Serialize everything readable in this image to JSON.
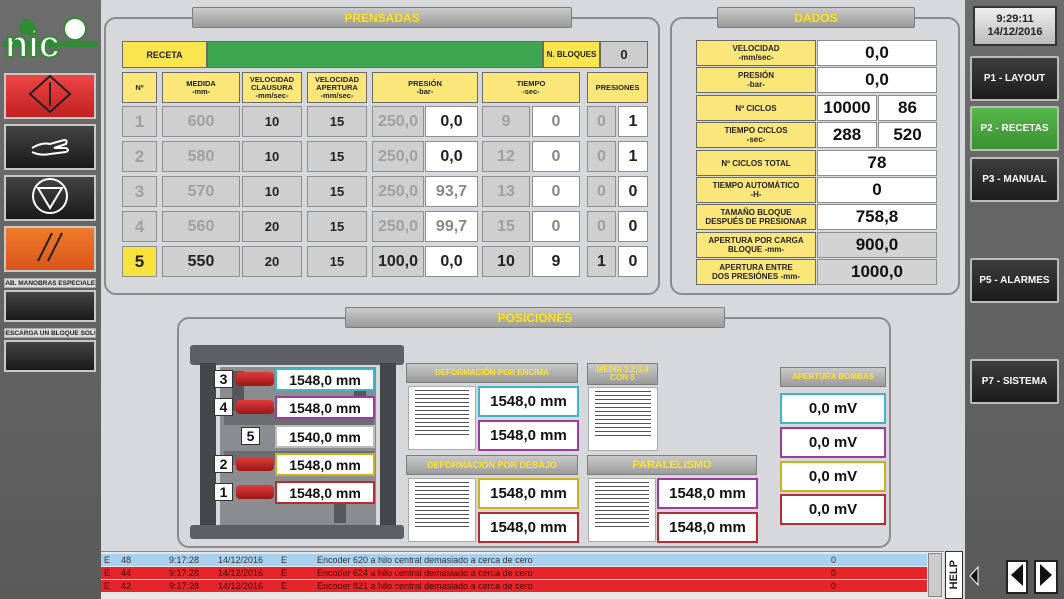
{
  "clock": {
    "time": "9:29:11",
    "date": "14/12/2016"
  },
  "nav": [
    {
      "label": "P1 - LAYOUT",
      "active": false
    },
    {
      "label": "P2 - RECETAS",
      "active": true
    },
    {
      "label": "P3 - MANUAL",
      "active": false
    },
    {
      "label": "P5 - ALARMES",
      "active": false
    },
    {
      "label": "P7 - SISTEMA",
      "active": false
    }
  ],
  "side": {
    "special_label": "HAB. MANOBRAS ESPECIALES",
    "unload_label": "DESCARGA UN BLOQUE SOLO"
  },
  "prensadas": {
    "title": "PRENSADAS",
    "receta_label": "RECETA",
    "bloques_label": "N. BLOQUES",
    "bloques_value": "0",
    "headers": {
      "n": "Nº",
      "medida": [
        "MEDIDA",
        "-mm-"
      ],
      "vel_cl": [
        "VELOCIDAD",
        "CLAUSURA",
        "-mm/sec-"
      ],
      "vel_ap": [
        "VELOCIDAD",
        "APERTURA",
        "-mm/sec-"
      ],
      "presion": [
        "PRESIÓN",
        "-bar-"
      ],
      "tiempo": [
        "TIEMPO",
        "-sec-"
      ],
      "presiones": "PRESIONES"
    },
    "rows": [
      {
        "n": "1",
        "medida": "600",
        "vcl": "10",
        "vap": "15",
        "pres_set": "250,0",
        "pres_act": "0,0",
        "t_set": "9",
        "t_act": "0",
        "p_set": "0",
        "p_act": "1"
      },
      {
        "n": "2",
        "medida": "580",
        "vcl": "10",
        "vap": "15",
        "pres_set": "250,0",
        "pres_act": "0,0",
        "t_set": "12",
        "t_act": "0",
        "p_set": "0",
        "p_act": "1"
      },
      {
        "n": "3",
        "medida": "570",
        "vcl": "10",
        "vap": "15",
        "pres_set": "250,0",
        "pres_act": "93,7",
        "t_set": "13",
        "t_act": "0",
        "p_set": "0",
        "p_act": "0"
      },
      {
        "n": "4",
        "medida": "560",
        "vcl": "20",
        "vap": "15",
        "pres_set": "250,0",
        "pres_act": "99,7",
        "t_set": "15",
        "t_act": "0",
        "p_set": "0",
        "p_act": "0"
      },
      {
        "n": "5",
        "medida": "550",
        "vcl": "20",
        "vap": "15",
        "pres_set": "100,0",
        "pres_act": "0,0",
        "t_set": "10",
        "t_act": "9",
        "p_set": "1",
        "p_act": "0"
      }
    ]
  },
  "dados": {
    "title": "DADOS",
    "rows": [
      {
        "label": [
          "VELOCIDAD",
          "-mm/sec-"
        ],
        "value": "0,0"
      },
      {
        "label": [
          "PRESIÓN",
          "-bar-"
        ],
        "value": "0,0"
      },
      {
        "label": [
          "Nº CICLOS"
        ],
        "value": "10000",
        "value2": "86"
      },
      {
        "label": [
          "TIEMPO CICLOS",
          "-sec-"
        ],
        "value": "288",
        "value2": "520"
      },
      {
        "label": [
          "Nº CICLOS TOTAL"
        ],
        "value": "78"
      },
      {
        "label": [
          "TIEMPO AUTOMÁTICO",
          "-H-"
        ],
        "value": "0"
      },
      {
        "label": [
          "TAMAÑO BLOQUE",
          "DESPUÉS DE PRESIONAR"
        ],
        "value": "758,8"
      },
      {
        "label": [
          "APERTURA POR CARGA",
          "BLOQUE -mm-"
        ],
        "value": "900,0"
      },
      {
        "label": [
          "APERTURA ENTRE",
          "DOS PRESIÓNES -mm-"
        ],
        "value": "1000,0"
      }
    ]
  },
  "posiciones": {
    "title": "POSICIÓNES",
    "cylinders": [
      {
        "num": "3",
        "value": "1548,0 mm",
        "color": "#3fb6c4"
      },
      {
        "num": "4",
        "value": "1548,0 mm",
        "color": "#9c3c9c"
      },
      {
        "num": "5",
        "value": "1540,0 mm",
        "color": "#ffffff"
      },
      {
        "num": "2",
        "value": "1548,0 mm",
        "color": "#c9b21c"
      },
      {
        "num": "1",
        "value": "1548,0 mm",
        "color": "#b52c33"
      }
    ],
    "def_encima": {
      "title": "DEFORMACIÓN POR ENCIMA",
      "values": [
        "1548,0 mm",
        "1548,0 mm"
      ]
    },
    "media": {
      "title": [
        "MEDIA 1,2,3,4",
        "CON 5"
      ]
    },
    "def_debajo": {
      "title": "DEFORMACIÓN POR DEBAJO",
      "values": [
        "1548,0 mm",
        "1548,0 mm"
      ]
    },
    "paralelismo": {
      "title": "PARALELISMO",
      "values": [
        "1548,0 mm",
        "1548,0 mm"
      ]
    },
    "bombas": {
      "title": "APERTURA BOMBAS",
      "values": [
        "0,0 mV",
        "0,0 mV",
        "0,0 mV",
        "0,0 mV"
      ]
    }
  },
  "alarms": [
    {
      "flag": "E",
      "id": "48",
      "time": "9:17:28",
      "date": "14/12/2016",
      "type": "E",
      "text": "Encoder 620 a hilo central demasiado a cerca de cero",
      "count": "0"
    },
    {
      "flag": "E",
      "id": "44",
      "time": "9:17:28",
      "date": "14/12/2016",
      "type": "E",
      "text": "Encoder 624 a hilo central demasiado a cerca de cero",
      "count": "0"
    },
    {
      "flag": "E",
      "id": "42",
      "time": "9:17:28",
      "date": "14/12/2016",
      "type": "E",
      "text": "Encoder 821 a hilo central demasiado a cerca de cero",
      "count": "0"
    }
  ],
  "help_label": "HELP"
}
